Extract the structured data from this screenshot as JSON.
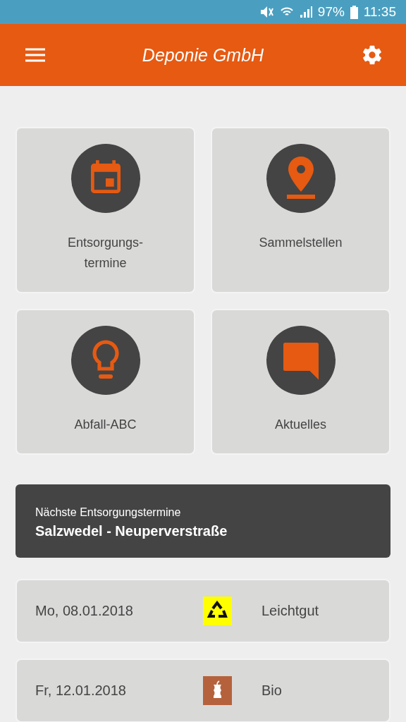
{
  "status_bar": {
    "battery": "97%",
    "time": "11:35"
  },
  "app_bar": {
    "title": "Deponie GmbH"
  },
  "tiles": [
    {
      "kind": "calendar",
      "label": "Entsorgungs-\ntermine"
    },
    {
      "kind": "pin",
      "label": "Sammelstellen"
    },
    {
      "kind": "bulb",
      "label": "Abfall-ABC"
    },
    {
      "kind": "chat",
      "label": "Aktuelles"
    }
  ],
  "next_dates": {
    "subtitle": "Nächste Entsorgungstermine",
    "location": "Salzwedel - Neuperverstraße"
  },
  "dates": [
    {
      "date": "Mo, 08.01.2018",
      "kind": "recycling",
      "color": "#ffff00",
      "label": "Leichtgut"
    },
    {
      "date": "Fr, 12.01.2018",
      "kind": "bio",
      "color": "#b5623c",
      "label": "Bio"
    }
  ]
}
